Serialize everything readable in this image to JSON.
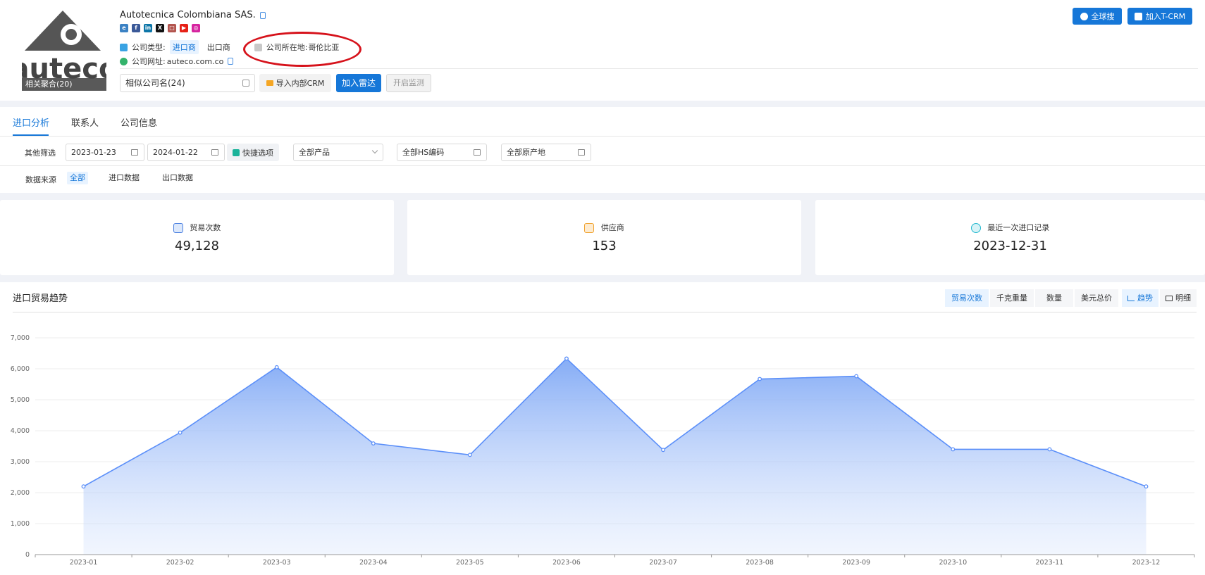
{
  "header": {
    "company_name": "Autotecnica Colombiana SAS.",
    "logo_text": "auteco",
    "logo_badge": "相关聚合(20)",
    "type_label": "公司类型:",
    "type_importer": "进口商",
    "type_exporter": "出口商",
    "location_label": "公司所在地:",
    "location_value": "哥伦比亚",
    "website_label": "公司网址:",
    "website_value": "auteco.com.co",
    "global_search": "全球搜",
    "add_tcrm": "加入T-CRM",
    "similar_company": "相似公司名(24)",
    "import_crm": "导入内部CRM",
    "add_radar": "加入雷达",
    "start_monitor": "开启监测"
  },
  "tabs": [
    "进口分析",
    "联系人",
    "公司信息"
  ],
  "filters": {
    "label": "其他筛选",
    "date_from": "2023-01-23",
    "date_to": "2024-01-22",
    "quick_option": "快捷选项",
    "product": "全部产品",
    "hs_code": "全部HS编码",
    "origin": "全部原产地"
  },
  "data_source": {
    "label": "数据来源",
    "options": [
      "全部",
      "进口数据",
      "出口数据"
    ]
  },
  "stats": [
    {
      "label": "贸易次数",
      "value": "49,128",
      "color": "#4a7fe0"
    },
    {
      "label": "供应商",
      "value": "153",
      "color": "#f0a22e"
    },
    {
      "label": "最近一次进口记录",
      "value": "2023-12-31",
      "color": "#22b8cf"
    }
  ],
  "chart_panel": {
    "title": "进口贸易趋势",
    "metric_tabs": [
      "贸易次数",
      "千克重量",
      "数量",
      "美元总价"
    ],
    "view_tabs": [
      "趋势",
      "明细"
    ]
  },
  "chart_data": {
    "type": "area",
    "title": "",
    "xlabel": "",
    "ylabel": "",
    "categories": [
      "2023-01",
      "2023-02",
      "2023-03",
      "2023-04",
      "2023-05",
      "2023-06",
      "2023-07",
      "2023-08",
      "2023-09",
      "2023-10",
      "2023-11",
      "2023-12"
    ],
    "series": [
      {
        "values": [
          2200,
          3940,
          6050,
          3590,
          3220,
          6330,
          3380,
          5670,
          5760,
          3400,
          3400,
          2200
        ]
      }
    ],
    "ylim": [
      0,
      7000
    ],
    "yticks": [
      0,
      1000,
      2000,
      3000,
      4000,
      5000,
      6000,
      7000
    ],
    "ytick_labels": [
      "0",
      "1,000",
      "2,000",
      "3,000",
      "4,000",
      "5,000",
      "6,000",
      "7,000"
    ],
    "grid": true,
    "line_color": "#5b8ff9"
  }
}
